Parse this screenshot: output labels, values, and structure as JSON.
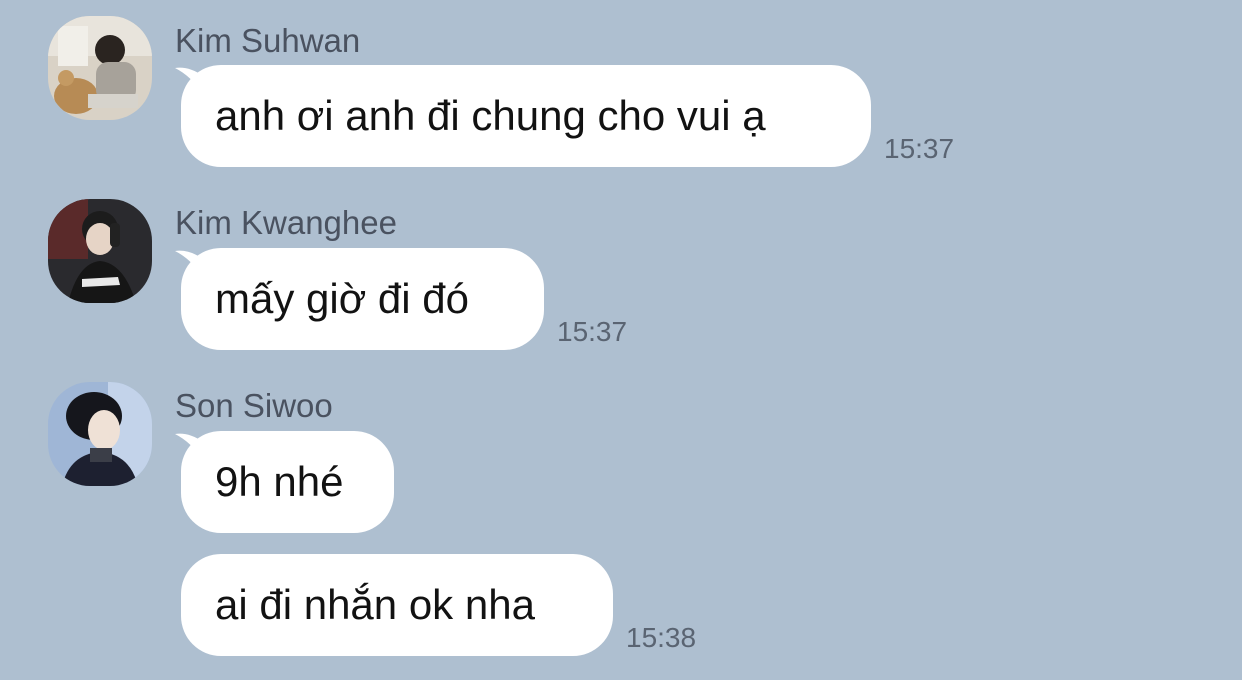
{
  "messages": [
    {
      "sender": "Kim Suhwan",
      "avatar_icon": "user-photo-icon",
      "text": "anh ơi anh đi chung cho vui ạ",
      "time": "15:37"
    },
    {
      "sender": "Kim Kwanghee",
      "avatar_icon": "user-photo-icon",
      "text": "mấy giờ đi đó",
      "time": "15:37"
    },
    {
      "sender": "Son Siwoo",
      "avatar_icon": "user-photo-icon",
      "text": "9h nhé",
      "time": ""
    },
    {
      "sender": "",
      "text": "ai đi nhắn ok nha",
      "time": "15:38"
    }
  ],
  "colors": {
    "background": "#aebfd0",
    "bubble": "#ffffff",
    "sender_text": "#4a5260",
    "time_text": "#5a6472"
  }
}
